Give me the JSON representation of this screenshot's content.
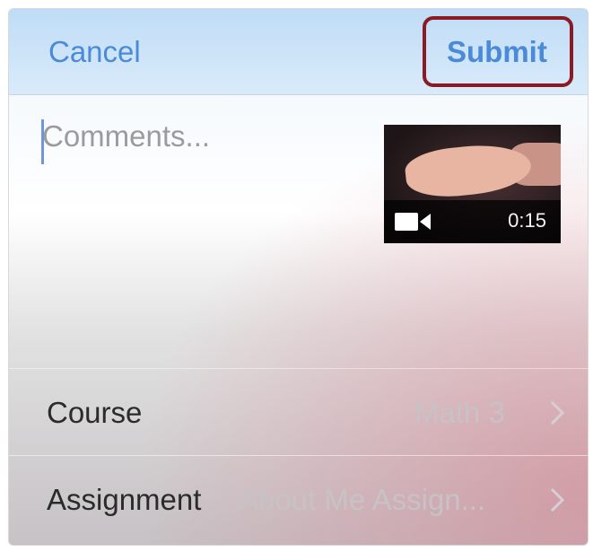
{
  "navbar": {
    "cancel_label": "Cancel",
    "submit_label": "Submit"
  },
  "comments": {
    "placeholder": "Comments..."
  },
  "video": {
    "duration": "0:15",
    "icon": "video-camera-icon"
  },
  "rows": [
    {
      "label": "Course",
      "value": "Math 3",
      "icon": "chevron-right-icon"
    },
    {
      "label": "Assignment",
      "value": "About Me Assign...",
      "icon": "chevron-right-icon"
    }
  ],
  "colors": {
    "accent": "#4a8ad8",
    "highlight": "#8b1a24",
    "caret": "#6f96d8"
  }
}
